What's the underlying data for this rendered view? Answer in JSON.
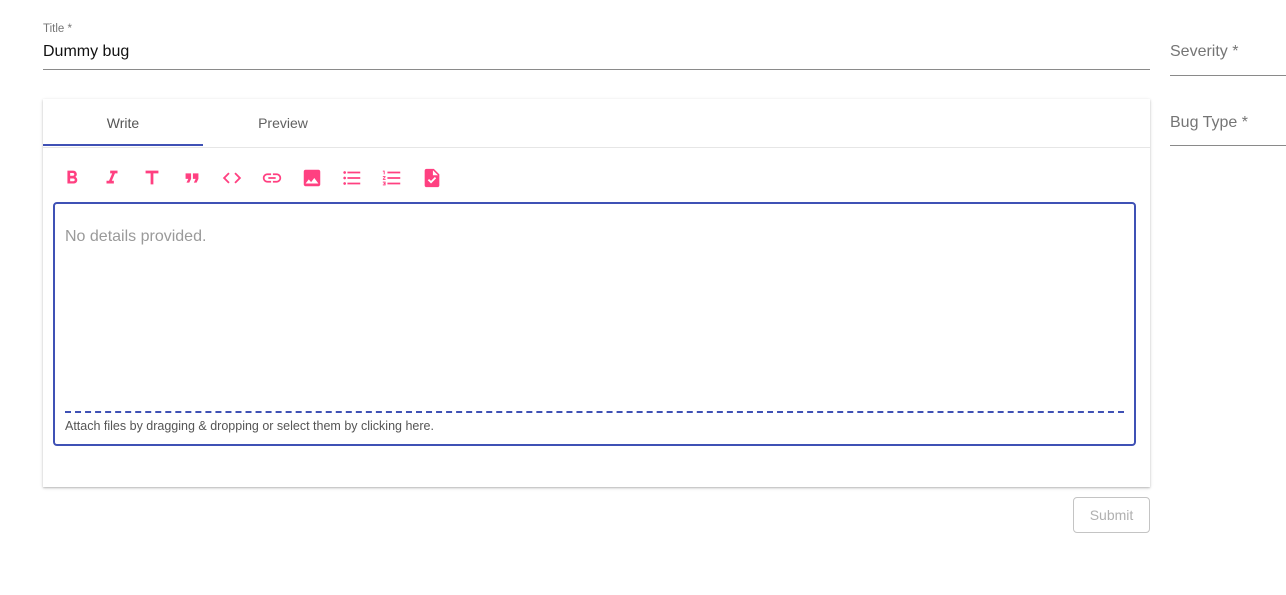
{
  "title_field": {
    "label": "Title *",
    "value": "Dummy bug"
  },
  "severity_field": {
    "label": "Severity *"
  },
  "bug_type_field": {
    "label": "Bug Type *"
  },
  "editor": {
    "tabs": [
      {
        "label": "Write",
        "active": true
      },
      {
        "label": "Preview",
        "active": false
      }
    ],
    "toolbar": [
      "bold-icon",
      "italic-icon",
      "heading-icon",
      "quote-icon",
      "code-icon",
      "link-icon",
      "image-icon",
      "bulleted-list-icon",
      "numbered-list-icon",
      "checklist-icon"
    ],
    "placeholder": "No details provided.",
    "attach_hint": "Attach files by dragging & dropping or select them by clicking here."
  },
  "submit_label": "Submit",
  "colors": {
    "accent": "#3f51b5",
    "icon": "#ff4081"
  }
}
